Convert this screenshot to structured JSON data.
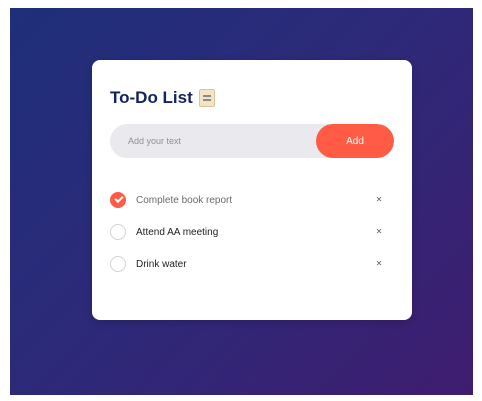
{
  "app": {
    "title": "To-Do List",
    "title_icon": "clipboard-icon"
  },
  "input": {
    "placeholder": "Add your text",
    "value": "",
    "add_label": "Add"
  },
  "tasks": [
    {
      "label": "Complete book report",
      "checked": true,
      "delete_label": "×"
    },
    {
      "label": "Attend AA meeting",
      "checked": false,
      "delete_label": "×"
    },
    {
      "label": "Drink water",
      "checked": false,
      "delete_label": "×"
    }
  ],
  "colors": {
    "background_start": "#1f2f7a",
    "background_end": "#3f1d6f",
    "accent": "#ff5b45",
    "title": "#13245d",
    "input_bg": "#e9e9ee",
    "card": "#ffffff"
  }
}
